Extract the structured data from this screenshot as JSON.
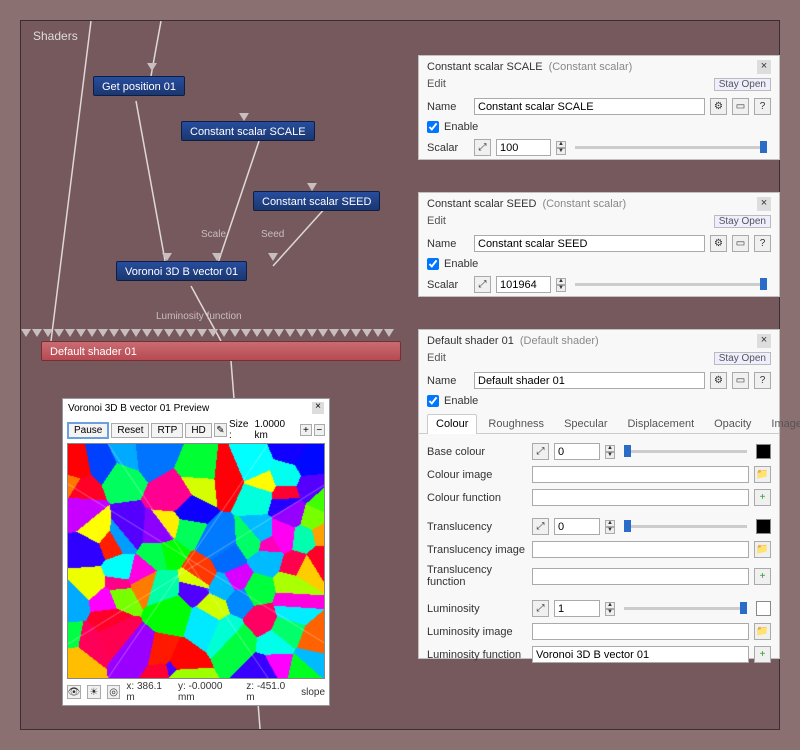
{
  "canvas": {
    "title": "Shaders"
  },
  "nodes": {
    "get_position": "Get position 01",
    "scale": "Constant scalar SCALE",
    "seed": "Constant scalar SEED",
    "voronoi": "Voronoi 3D B vector 01",
    "default": "Default shader 01",
    "label_scale": "Scale",
    "label_seed": "Seed",
    "label_lum": "Luminosity function"
  },
  "panel_scale": {
    "title": "Constant scalar SCALE",
    "subtitle": "(Constant scalar)",
    "edit": "Edit",
    "stay": "Stay Open",
    "name_lbl": "Name",
    "name_val": "Constant scalar SCALE",
    "enable_lbl": "Enable",
    "scalar_lbl": "Scalar",
    "scalar_val": "100"
  },
  "panel_seed": {
    "title": "Constant scalar SEED",
    "subtitle": "(Constant scalar)",
    "edit": "Edit",
    "stay": "Stay Open",
    "name_lbl": "Name",
    "name_val": "Constant scalar SEED",
    "enable_lbl": "Enable",
    "scalar_lbl": "Scalar",
    "scalar_val": "101964"
  },
  "panel_shader": {
    "title": "Default shader 01",
    "subtitle": "(Default shader)",
    "edit": "Edit",
    "stay": "Stay Open",
    "name_lbl": "Name",
    "name_val": "Default shader 01",
    "enable_lbl": "Enable",
    "tabs": {
      "colour": "Colour",
      "roughness": "Roughness",
      "specular": "Specular",
      "displacement": "Displacement",
      "opacity": "Opacity",
      "images": "Images"
    },
    "base_colour_lbl": "Base colour",
    "base_colour_val": "0",
    "colour_image_lbl": "Colour image",
    "colour_func_lbl": "Colour function",
    "translucency_lbl": "Translucency",
    "translucency_val": "0",
    "trans_image_lbl": "Translucency image",
    "trans_func_lbl": "Translucency function",
    "luminosity_lbl": "Luminosity",
    "luminosity_val": "1",
    "lum_image_lbl": "Luminosity image",
    "lum_func_lbl": "Luminosity function",
    "lum_func_val": "Voronoi 3D B vector 01"
  },
  "preview": {
    "title": "Voronoi 3D B vector 01 Preview",
    "pause": "Pause",
    "reset": "Reset",
    "rtp": "RTP",
    "hd": "HD",
    "size_lbl": "Size :",
    "size_val": "1.0000 km",
    "x": "x: 386.1 m",
    "y": "y: -0.0000 mm",
    "z": "z: -451.0 m",
    "slope": "slope"
  }
}
